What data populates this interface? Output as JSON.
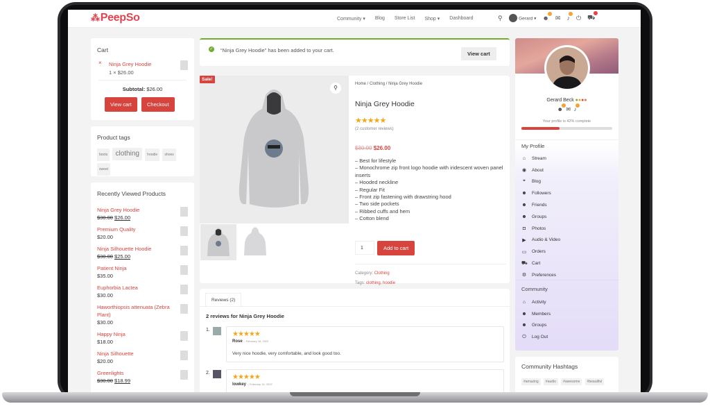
{
  "app": {
    "logo_text": "PeepSo",
    "logo_mark": "⁂"
  },
  "nav": {
    "items": [
      "Community ▾",
      "Blog",
      "Store List",
      "Shop ▾",
      "Dashboard"
    ],
    "user": "Gerard ▾"
  },
  "cart": {
    "title": "Cart",
    "item_name": "Ninja Grey Hoodie",
    "item_qty": "1 × $26.00",
    "subtotal_label": "Subtotal:",
    "subtotal_value": "$26.00",
    "view_cart": "View cart",
    "checkout": "Checkout"
  },
  "tags": {
    "title": "Product tags",
    "items": [
      "boots",
      "clothing",
      "hoodie",
      "shoes",
      "sweet"
    ]
  },
  "recent": {
    "title": "Recently Viewed Products",
    "items": [
      {
        "name": "Ninja Grey Hoodie",
        "old": "$30.00",
        "price": "$26.00"
      },
      {
        "name": "Premium Quality",
        "old": "",
        "price": "$20.00"
      },
      {
        "name": "Ninja Silhouette Hoodie",
        "old": "$30.00",
        "price": "$25.00"
      },
      {
        "name": "Patient Ninja",
        "old": "",
        "price": "$35.00"
      },
      {
        "name": "Euphorbia Lactea",
        "old": "",
        "price": "$30.00"
      },
      {
        "name": "Haworthiopsis attenuata (Zebra Plant)",
        "old": "",
        "price": "$30.00"
      },
      {
        "name": "Happy Ninja",
        "old": "",
        "price": "$18.00"
      },
      {
        "name": "Ninja Silhouette",
        "old": "",
        "price": "$20.00"
      },
      {
        "name": "Greenlights",
        "old": "$30.00",
        "price": "$18.99"
      }
    ]
  },
  "notice": {
    "text": "“Ninja Grey Hoodie” has been added to your cart.",
    "button": "View cart"
  },
  "product": {
    "sale": "Sale!",
    "breadcrumb_home": "Home",
    "breadcrumb_cat": "Clothing",
    "breadcrumb_item": "Ninja Grey Hoodie",
    "title": "Ninja Grey Hoodie",
    "rating_text": "(2 customer reviews)",
    "old_price": "$30.00",
    "price": "$26.00",
    "features": [
      "– Best for lifestyle",
      "– Monochrome zip front logo hoodie with iridescent woven panel inserts",
      "– Hooded neckline",
      "– Regular Fit",
      "– Front zip fastening with drawstring hood",
      "– Two side pockets",
      "– Ribbed cuffs and hem",
      "– Cotton blend"
    ],
    "qty": "1",
    "add_to_cart": "Add to cart",
    "category_label": "Category:",
    "category": "Clothing",
    "tags_label": "Tags:",
    "tags": "clothing, hoodie"
  },
  "reviews": {
    "tab": "Reviews (2)",
    "heading": "2 reviews for Ninja Grey Hoodie",
    "items": [
      {
        "num": "1.",
        "author": "Rose",
        "date": "– February 16, 2022",
        "text": "Very nice hoodie, very comfortable, and look good too."
      },
      {
        "num": "2.",
        "author": "lowkey",
        "date": "– February 16, 2022",
        "text": ""
      }
    ]
  },
  "profile": {
    "name": "Gerard Beck",
    "completion": "Your profile is 42% complete",
    "progress": 0.42
  },
  "my_profile": {
    "title": "My Profile",
    "items": [
      {
        "icon": "home-icon",
        "glyph": "⌂",
        "label": "Stream"
      },
      {
        "icon": "user-icon",
        "glyph": "◉",
        "label": "About"
      },
      {
        "icon": "quote-icon",
        "glyph": "❞",
        "label": "Blog"
      },
      {
        "icon": "followers-icon",
        "glyph": "☻",
        "label": "Followers"
      },
      {
        "icon": "friends-icon",
        "glyph": "☻",
        "label": "Friends"
      },
      {
        "icon": "groups-icon",
        "glyph": "☻",
        "label": "Groups"
      },
      {
        "icon": "camera-icon",
        "glyph": "◘",
        "label": "Photos"
      },
      {
        "icon": "video-icon",
        "glyph": "▶",
        "label": "Audio & Video"
      },
      {
        "icon": "orders-icon",
        "glyph": "▭",
        "label": "Orders"
      },
      {
        "icon": "cart-icon",
        "glyph": "⛟",
        "label": "Cart"
      },
      {
        "icon": "gear-icon",
        "glyph": "⚙",
        "label": "Preferences"
      }
    ]
  },
  "community": {
    "title": "Community",
    "items": [
      {
        "icon": "home-icon",
        "glyph": "⌂",
        "label": "Activity"
      },
      {
        "icon": "members-icon",
        "glyph": "☻",
        "label": "Members"
      },
      {
        "icon": "groups-icon",
        "glyph": "☻",
        "label": "Groups"
      },
      {
        "icon": "power-icon",
        "glyph": "⏻",
        "label": "Log Out"
      }
    ]
  },
  "hashtags": {
    "title": "Community Hashtags",
    "items": [
      "#amazing",
      "#audio",
      "#awesome",
      "#beautiful"
    ]
  }
}
